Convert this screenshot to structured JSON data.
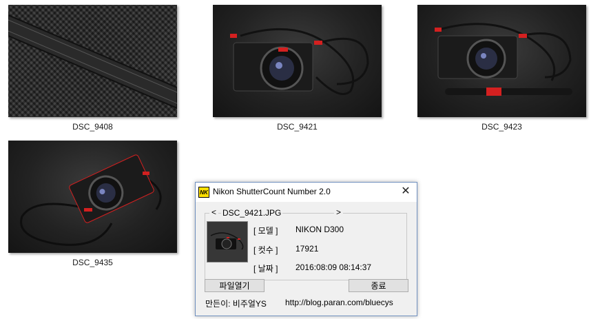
{
  "files": [
    {
      "name": "DSC_9408"
    },
    {
      "name": "DSC_9421"
    },
    {
      "name": "DSC_9423"
    },
    {
      "name": "DSC_9435"
    }
  ],
  "dialog": {
    "title": "Nikon ShutterCount Number 2.0",
    "icon_text": "NK",
    "close_glyph": "✕",
    "prev_glyph": "<",
    "next_glyph": ">",
    "filename": "DSC_9421.JPG",
    "model_label": "[ 모델 ]",
    "model_value": "NIKON D300",
    "count_label": "[ 컷수 ]",
    "count_value": "17921",
    "date_label": "[ 날짜 ]",
    "date_value": "2016:08:09 08:14:37",
    "open_button": "파일열기",
    "exit_button": "종료",
    "author": "만든이: 비주얼YS",
    "url": "http://blog.paran.com/bluecys"
  },
  "colors": {
    "strap_red": "#d42020",
    "dialog_border": "#6f8fbf"
  }
}
